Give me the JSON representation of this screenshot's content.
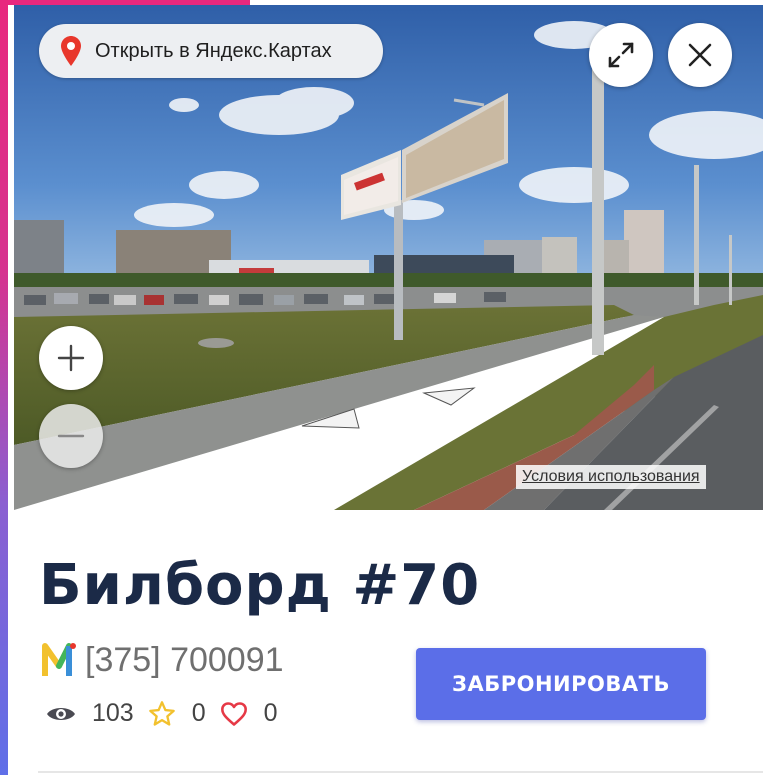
{
  "panorama": {
    "open_in_maps_label": "Открыть в Яндекс.Картах",
    "terms_label": "Условия использования",
    "icons": {
      "pin": "map-pin-icon",
      "expand": "expand-icon",
      "close": "close-icon",
      "zoom_in": "plus-icon",
      "zoom_out": "minus-icon"
    }
  },
  "listing": {
    "title": "Билборд #70",
    "phone": "[375] 700091",
    "views": "103",
    "favorites": "0",
    "likes": "0",
    "book_label": "ЗАБРОНИРОВАТЬ"
  },
  "colors": {
    "accent": "#5b6ee8",
    "title": "#1b2a47",
    "pin_red": "#e8372c",
    "star_yellow": "#f2c12e",
    "heart_red": "#e63946"
  }
}
